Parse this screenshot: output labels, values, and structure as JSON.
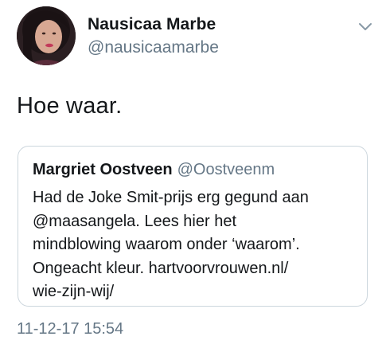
{
  "tweet": {
    "author": {
      "display_name": "Nausicaa Marbe",
      "handle": "@nausicaamarbe",
      "avatar_icon": "profile-photo"
    },
    "menu_icon": "chevron-down-icon",
    "text": "Hoe waar.",
    "quoted_tweet": {
      "display_name": "Margriet Oostveen",
      "handle": "@Oostveenm",
      "lines": [
        "Had de Joke Smit-prijs erg gegund aan",
        "@maasangela. Lees hier het",
        "mindblowing waarom onder ‘waarom’.",
        "Ongeacht kleur. hartvoorvrouwen.nl/",
        "wie-zijn-wij/"
      ]
    },
    "timestamp": "11-12-17 15:54"
  },
  "colors": {
    "text_primary": "#14171a",
    "text_secondary": "#657786",
    "card_border": "#ccd6dd"
  }
}
